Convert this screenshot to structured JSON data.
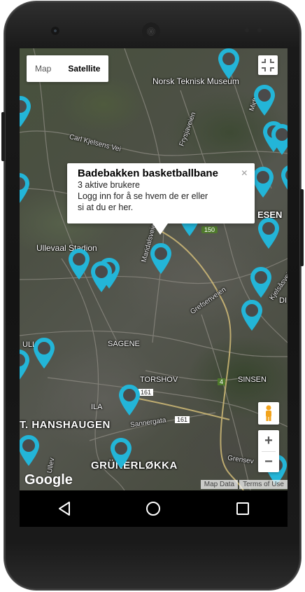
{
  "map_controls": {
    "map_label": "Map",
    "satellite_label": "Satellite",
    "zoom_in": "+",
    "zoom_out": "−"
  },
  "info_window": {
    "title": "Badebakken basketballbane",
    "subtitle": "3 aktive brukere",
    "message_line1": "Logg inn for å se hvem de er eller",
    "message_line2": "si at du er her.",
    "close": "×"
  },
  "map_labels": {
    "ntnu": "Norsk Teknisk Museum",
    "ullevaal": "Ullevaal Stadion",
    "sagene": "SAGENE",
    "torshov": "TORSHOV",
    "sinsen": "SINSEN",
    "hanshaugen": "T. HANSHAUGEN",
    "grunerlokka": "GRÜNERLØKKA",
    "ila": "ILA",
    "ulle": "ULLE",
    "esen": "ESEN",
    "carl": "Carl Kjelsens Vei",
    "frysja": "Frysjaveien",
    "maridal": "Maridalsveien",
    "grefsen": "Grefsenveien",
    "sannergata": "Sannergata",
    "kjelsas": "Kjelsåsveien",
    "midtoc": "Midtoc",
    "ullev": "Ullev",
    "grensev": "Grensev",
    "di": "DI",
    "route150": "150",
    "route161a": "161",
    "route161b": "161",
    "route4": "4"
  },
  "attribution": {
    "logo": "Google",
    "map_data": "Map Data",
    "terms": "Terms of Use"
  },
  "colors": {
    "pin": "#23b5d8",
    "pin_dot": "#4a4a4a"
  },
  "icons": {
    "back": "back-triangle-icon",
    "home": "home-circle-icon",
    "recents": "recents-square-icon",
    "fullscreen": "fullscreen-exit-icon",
    "pegman": "pegman-icon"
  }
}
